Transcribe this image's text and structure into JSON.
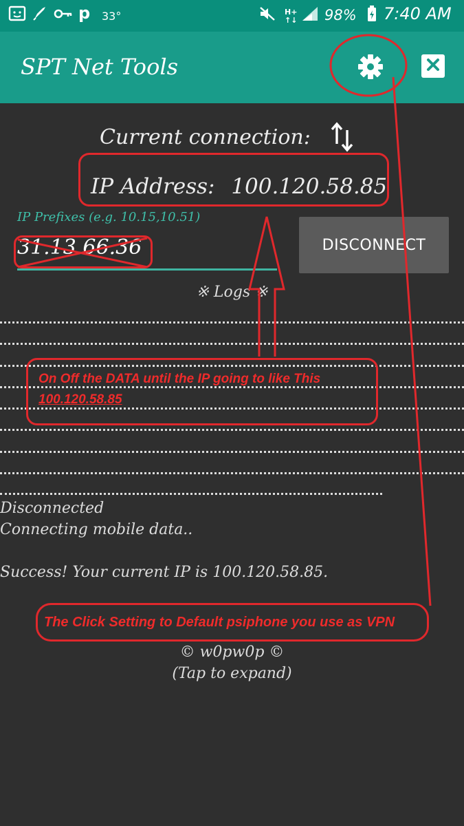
{
  "status_bar": {
    "temperature": "33°",
    "battery": "98%",
    "time": "7:40 AM",
    "icons": [
      "notification-icon",
      "rocket-icon",
      "key-icon",
      "parking-icon",
      "mute-icon",
      "hplus-signal-icon",
      "signal-bars-icon",
      "battery-charging-icon"
    ]
  },
  "app_bar": {
    "title": "SPT Net Tools",
    "settings_icon": "gear-icon",
    "close_icon": "close-icon"
  },
  "connection": {
    "label": "Current connection:",
    "ip_label": "IP Address:",
    "ip_value": "100.120.58.85"
  },
  "prefix": {
    "label": "IP Prefixes (e.g. 10.15,10.51)",
    "value": "31.13.66.36"
  },
  "disconnect_label": "DISCONNECT",
  "logs": {
    "header": "※ Logs ※",
    "lines": [
      "Disconnected",
      "Connecting mobile data..",
      "Success! Your current IP is 100.120.58.85."
    ]
  },
  "footer": {
    "credit": "© w0pw0p ©",
    "hint": "(Tap to expand)"
  },
  "annotations": {
    "note1_line1": "On Off the DATA until the IP going to like This",
    "note1_line2": "100.120.58.85",
    "note2": "The Click Setting to Default psiphone you use as VPN",
    "color": "#e0282c"
  },
  "colors": {
    "status_bar": "#0a8f7c",
    "app_bar": "#199c8a",
    "background": "#2f2f2f",
    "accent": "#3fc0aa",
    "button": "#5b5b5b"
  }
}
